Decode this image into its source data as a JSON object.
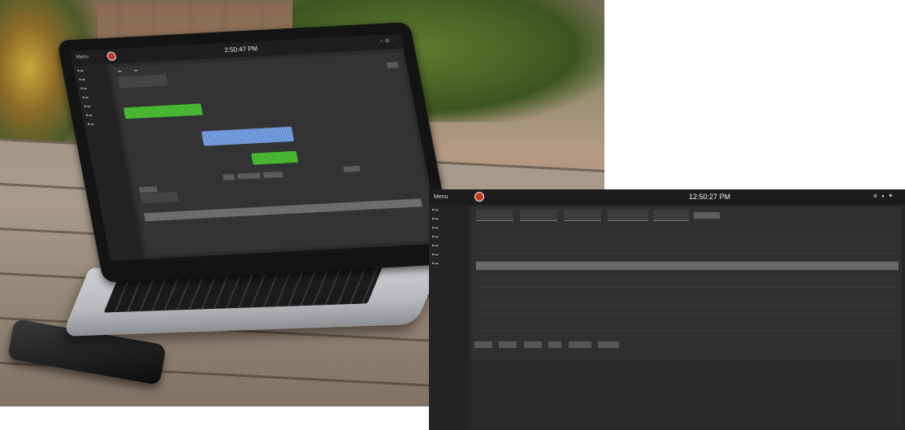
{
  "laptop": {
    "menu_label": "Menu",
    "clock": "2:50:47 PM",
    "toolbar_icons": [
      "search-icon",
      "gear-icon",
      "more-icon"
    ],
    "accent_wave_green": "#55d23a",
    "accent_wave_blue": "#6f9be0"
  },
  "desktop": {
    "menu_label": "Menu",
    "clock": "12:50:27 PM",
    "toolbar_icons": [
      "gear-icon",
      "user-icon",
      "flag-icon"
    ],
    "selected_row_color": "#6a6a6a"
  }
}
